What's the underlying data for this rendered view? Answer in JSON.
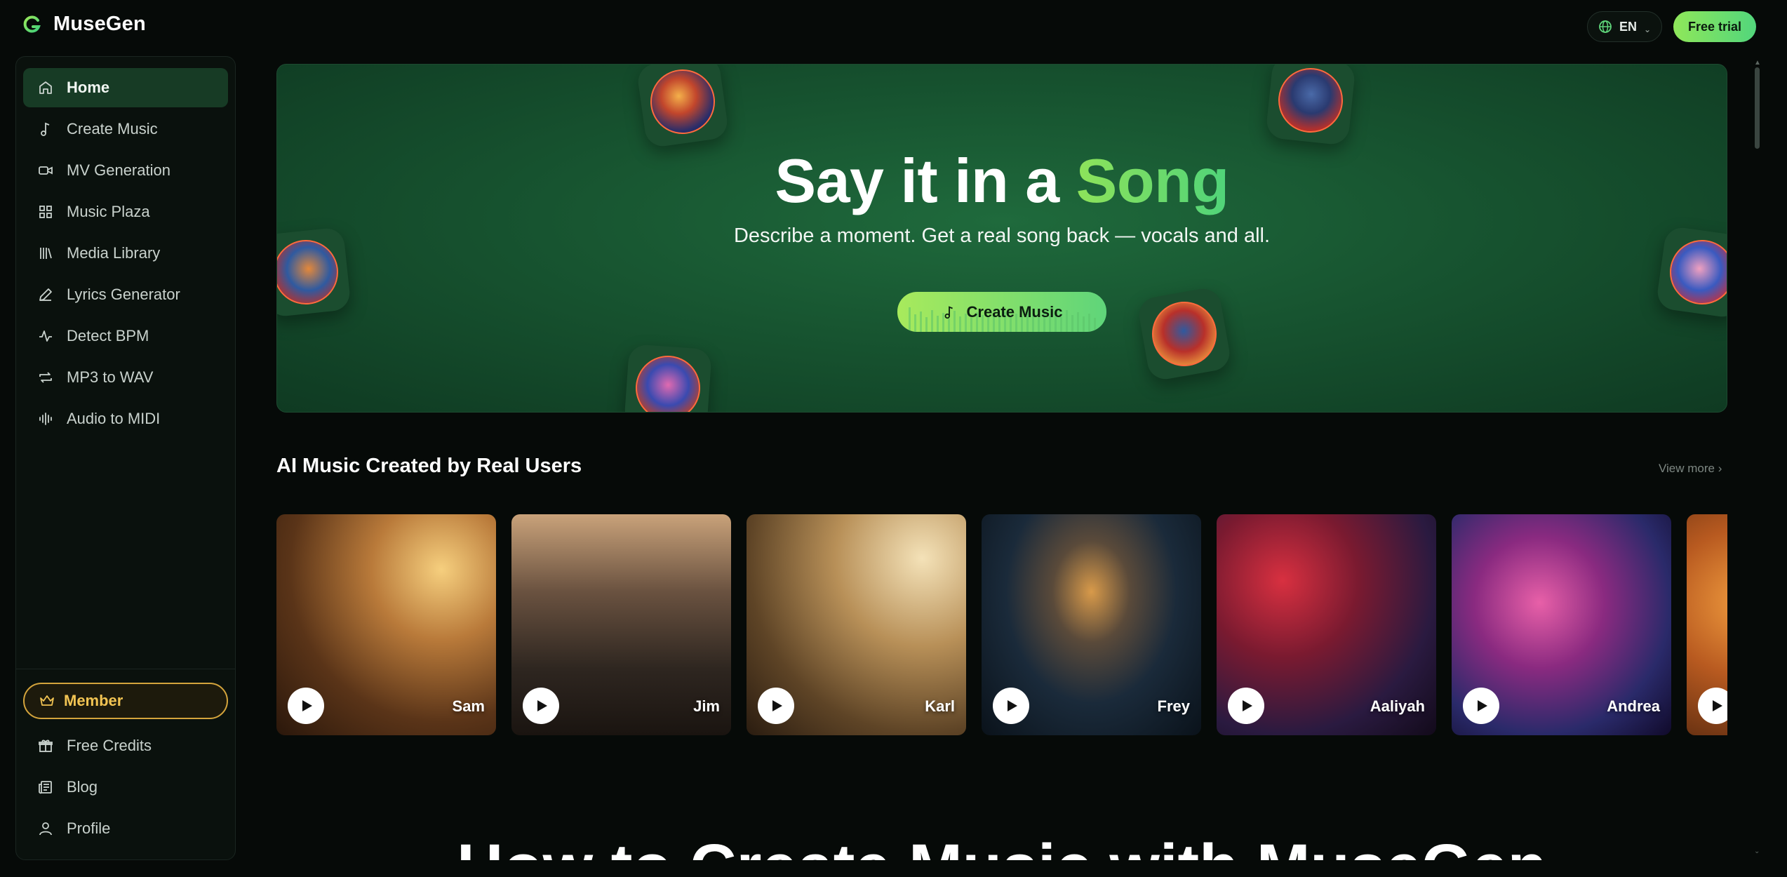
{
  "app": {
    "name": "MuseGen"
  },
  "header": {
    "language": "EN",
    "trial_label": "Free trial"
  },
  "sidebar": {
    "items": [
      {
        "label": "Home",
        "icon": "home-icon",
        "active": true
      },
      {
        "label": "Create Music",
        "icon": "music-note-icon"
      },
      {
        "label": "MV Generation",
        "icon": "video-camera-icon"
      },
      {
        "label": "Music Plaza",
        "icon": "grid-icon"
      },
      {
        "label": "Media Library",
        "icon": "library-icon"
      },
      {
        "label": "Lyrics Generator",
        "icon": "pen-icon"
      },
      {
        "label": "Detect BPM",
        "icon": "pulse-icon"
      },
      {
        "label": "MP3 to WAV",
        "icon": "convert-icon"
      },
      {
        "label": "Audio to MIDI",
        "icon": "waveform-icon"
      }
    ],
    "member_label": "Member",
    "bottom_items": [
      {
        "label": "Free Credits",
        "icon": "gift-icon"
      },
      {
        "label": "Blog",
        "icon": "newspaper-icon"
      },
      {
        "label": "Profile",
        "icon": "user-icon"
      }
    ]
  },
  "hero": {
    "title_main": "Say it in a",
    "title_accent": "Song",
    "subtitle": "Describe a moment. Get a real song back — vocals and all.",
    "cta_label": "Create Music"
  },
  "showcase": {
    "title": "AI Music Created by Real Users",
    "view_more": "View more ›",
    "cards": [
      {
        "name": "Sam"
      },
      {
        "name": "Jim"
      },
      {
        "name": "Karl"
      },
      {
        "name": "Frey"
      },
      {
        "name": "Aaliyah"
      },
      {
        "name": "Andrea"
      }
    ]
  },
  "next_section": {
    "title": "How to Create Music with MuseGen"
  },
  "colors": {
    "accent": "#7cdc55",
    "member": "#f2c453",
    "background": "#060a08",
    "hero": "#175430"
  }
}
